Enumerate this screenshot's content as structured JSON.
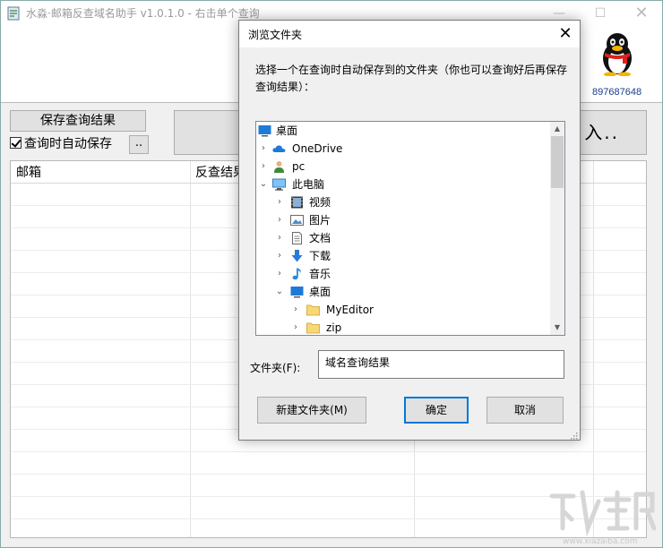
{
  "main_window": {
    "title": "水淼·邮箱反查域名助手 v1.0.1.0 - 右击单个查询",
    "controls": {
      "minimize": "—",
      "maximize": "☐",
      "close": "✕"
    },
    "qq_number": "897687648",
    "save_results_label": "保存查询结果",
    "auto_save_label": "查询时自动保存",
    "auto_save_checked": true,
    "browse_label": "..",
    "import_label": "入..",
    "grid_headers": [
      "邮箱",
      "反查结果"
    ]
  },
  "dialog": {
    "title": "浏览文件夹",
    "close": "✕",
    "description": "选择一个在查询时自动保存到的文件夹（你也可以查询好后再保存查询结果）：",
    "tree": [
      {
        "label": "桌面",
        "icon": "desktop-icon",
        "arrow": ""
      },
      {
        "label": "OneDrive",
        "icon": "cloud-icon",
        "arrow": "›"
      },
      {
        "label": "pc",
        "icon": "user-icon",
        "arrow": "›"
      },
      {
        "label": "此电脑",
        "icon": "computer-icon",
        "arrow": "⌄"
      },
      {
        "label": "视频",
        "icon": "video-icon",
        "arrow": "›"
      },
      {
        "label": "图片",
        "icon": "picture-icon",
        "arrow": "›"
      },
      {
        "label": "文档",
        "icon": "document-icon",
        "arrow": "›"
      },
      {
        "label": "下载",
        "icon": "download-icon",
        "arrow": "›"
      },
      {
        "label": "音乐",
        "icon": "music-icon",
        "arrow": "›"
      },
      {
        "label": "桌面",
        "icon": "desktop-icon",
        "arrow": "⌄"
      },
      {
        "label": "MyEditor",
        "icon": "folder-icon",
        "arrow": "›"
      },
      {
        "label": "zip",
        "icon": "folder-icon",
        "arrow": "›"
      }
    ],
    "folder_label": "文件夹(F):",
    "folder_value": "域名查询结果",
    "new_folder_label": "新建文件夹(M)",
    "ok_label": "确定",
    "cancel_label": "取消"
  },
  "watermark": {
    "url": "www.xiazaiba.com"
  },
  "colors": {
    "accent": "#0078d7",
    "qq_number": "#1a3c8a"
  }
}
